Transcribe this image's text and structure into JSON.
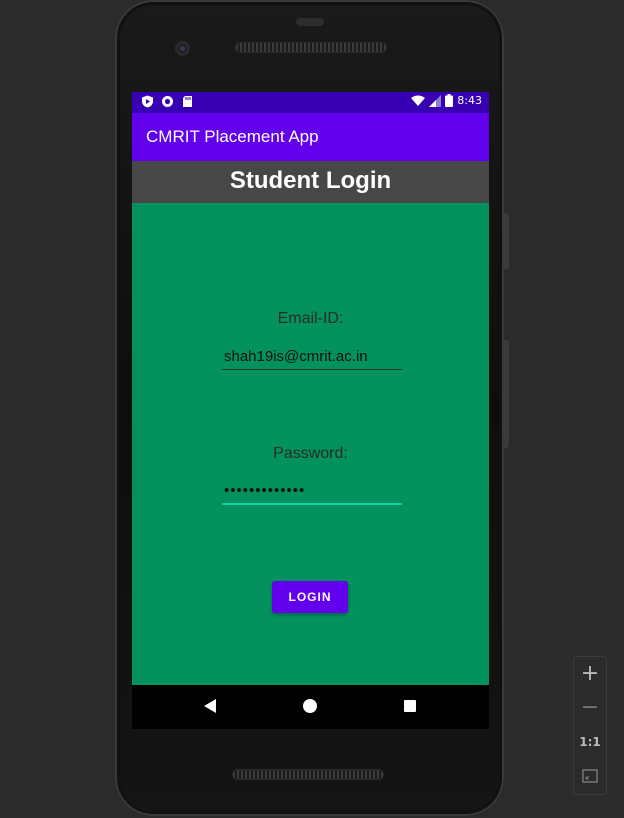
{
  "status_bar": {
    "time": "8:43",
    "left_icons": [
      "play-protect-icon",
      "record-icon",
      "sd-card-icon"
    ],
    "right_icons": [
      "wifi-icon",
      "signal-icon",
      "battery-icon"
    ]
  },
  "app_bar": {
    "title": "CMRIT Placement App"
  },
  "header": {
    "title": "Student Login"
  },
  "form": {
    "email_label": "Email-ID:",
    "email_value": "shah19is@cmrit.ac.in",
    "password_label": "Password:",
    "password_value": "•••••••••••••",
    "login_button": "LOGIN"
  },
  "navigation": {
    "back_icon": "back-icon",
    "home_icon": "home-icon",
    "recents_icon": "recents-icon"
  },
  "zoom_controls": {
    "zoom_in": "+",
    "zoom_out": "−",
    "actual_size": "1:1"
  },
  "colors": {
    "status_bar": "#3700b3",
    "app_bar": "#6200ee",
    "header_band": "#474747",
    "screen_background": "#03915e",
    "focused_underline": "#0cd3a2"
  }
}
